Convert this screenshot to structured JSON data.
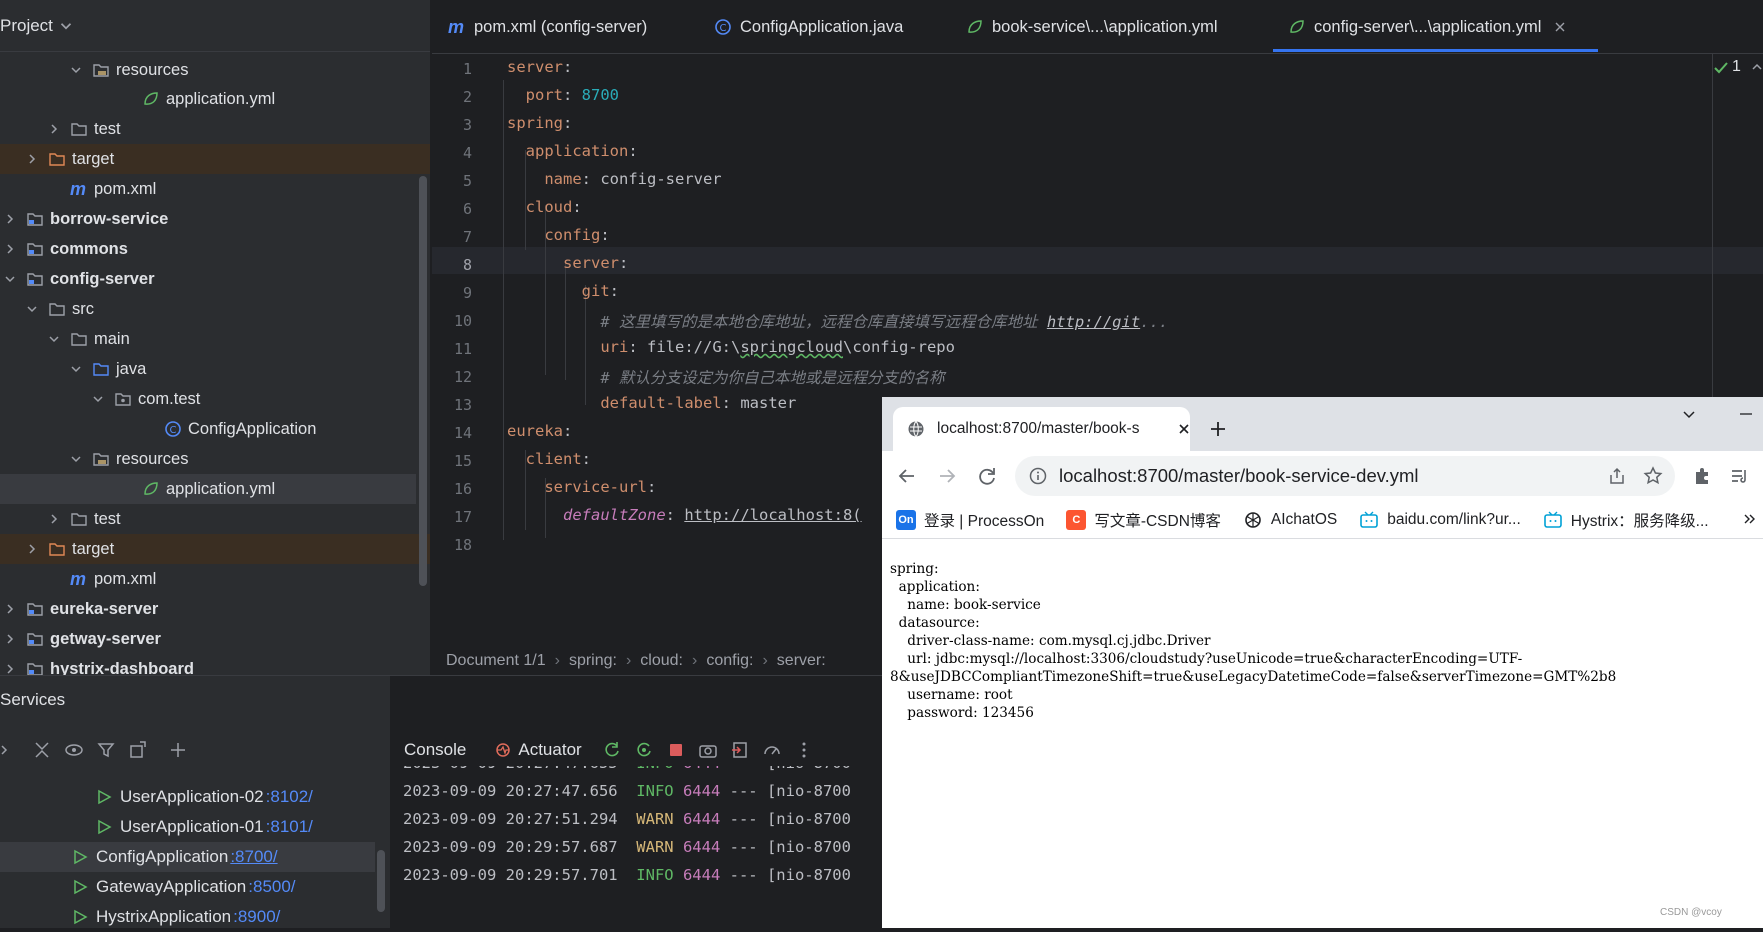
{
  "project": {
    "header": "Project",
    "tree": [
      {
        "label": "resources",
        "type": "folder-res",
        "open": true
      },
      {
        "label": "application.yml",
        "type": "yml"
      },
      {
        "label": "test",
        "type": "folder",
        "open": false
      },
      {
        "label": "target",
        "type": "folder-excl",
        "open": false
      },
      {
        "label": "pom.xml",
        "type": "maven"
      },
      {
        "label": "borrow-service",
        "type": "module",
        "open": false
      },
      {
        "label": "commons",
        "type": "module",
        "open": false
      },
      {
        "label": "config-server",
        "type": "module",
        "open": true
      },
      {
        "label": "src",
        "type": "folder",
        "open": true
      },
      {
        "label": "main",
        "type": "folder",
        "open": true
      },
      {
        "label": "java",
        "type": "folder-src",
        "open": true
      },
      {
        "label": "com.test",
        "type": "package",
        "open": true
      },
      {
        "label": "ConfigApplication",
        "type": "class"
      },
      {
        "label": "resources",
        "type": "folder-res",
        "open": true
      },
      {
        "label": "application.yml",
        "type": "yml"
      },
      {
        "label": "test",
        "type": "folder",
        "open": false
      },
      {
        "label": "target",
        "type": "folder-excl",
        "open": false
      },
      {
        "label": "pom.xml",
        "type": "maven"
      },
      {
        "label": "eureka-server",
        "type": "module",
        "open": false
      },
      {
        "label": "getway-server",
        "type": "module",
        "open": false
      },
      {
        "label": "hystrix-dashboard",
        "type": "module",
        "open": false
      }
    ]
  },
  "editor": {
    "tabs": [
      {
        "label": "pom.xml (config-server)",
        "icon": "maven-icon"
      },
      {
        "label": "ConfigApplication.java",
        "icon": "class-icon"
      },
      {
        "label": "book-service\\...\\application.yml",
        "icon": "yml-icon"
      },
      {
        "label": "config-server\\...\\application.yml",
        "icon": "yml-icon",
        "active": true
      }
    ],
    "line_numbers": [
      "1",
      "2",
      "3",
      "4",
      "5",
      "6",
      "7",
      "8",
      "9",
      "10",
      "11",
      "12",
      "13",
      "14",
      "15",
      "16",
      "17",
      "18"
    ],
    "code": {
      "l1_key": "server",
      "l2_key": "port",
      "l2_val": "8700",
      "l3_key": "spring",
      "l4_key": "application",
      "l5_key": "name",
      "l5_val": "config-server",
      "l6_key": "cloud",
      "l7_key": "config",
      "l8_key": "server",
      "l9_key": "git",
      "l10_comment": "# 这里填写的是本地仓库地址，远程仓库直接填写远程仓库地址 ",
      "l10_link": "http://git",
      "l10_tail": "...",
      "l11_key": "uri",
      "l11_val_a": "file://G:\\",
      "l11_val_b": "springcloud",
      "l11_val_c": "\\config-repo",
      "l12_comment": "# 默认分支设定为你自己本地或是远程分支的名称",
      "l13_key": "default-label",
      "l13_val": "master",
      "l14_key": "eureka",
      "l15_key": "client",
      "l16_key": "service-url",
      "l17_key": "defaultZone",
      "l17_val": "http://localhost:8("
    },
    "breadcrumb": [
      "Document 1/1",
      "spring:",
      "cloud:",
      "config:",
      "server:"
    ],
    "inspection_count": "1"
  },
  "services": {
    "title": "Services",
    "items": [
      {
        "name": "UserApplication-02",
        "port": ":8102/"
      },
      {
        "name": "UserApplication-01",
        "port": ":8101/"
      },
      {
        "name": "ConfigApplication",
        "port": ":8700/",
        "selected": true
      },
      {
        "name": "GatewayApplication",
        "port": ":8500/"
      },
      {
        "name": "HystrixApplication",
        "port": ":8900/"
      }
    ]
  },
  "console": {
    "tabs": [
      "Console",
      "Actuator"
    ],
    "logs": [
      {
        "ts": "2023-09-09 20:27:47.655",
        "level": "INFO",
        "pid": "6444",
        "rest": " --- [nio-8700"
      },
      {
        "ts": "2023-09-09 20:27:47.656",
        "level": "INFO",
        "pid": "6444",
        "rest": " --- [nio-8700"
      },
      {
        "ts": "2023-09-09 20:27:51.294",
        "level": "WARN",
        "pid": "6444",
        "rest": " --- [nio-8700"
      },
      {
        "ts": "2023-09-09 20:29:57.687",
        "level": "WARN",
        "pid": "6444",
        "rest": " --- [nio-8700"
      },
      {
        "ts": "2023-09-09 20:29:57.701",
        "level": "INFO",
        "pid": "6444",
        "rest": " --- [nio-8700"
      }
    ]
  },
  "browser": {
    "tab_title": "localhost:8700/master/book-s",
    "url": "localhost:8700/master/book-service-dev.yml",
    "bookmarks": [
      {
        "label": "登录 | ProcessOn",
        "badge": "On",
        "color": "#1a73e8"
      },
      {
        "label": "写文章-CSDN博客",
        "badge": "C",
        "color": "#fc5531"
      },
      {
        "label": "AIchatOS",
        "badge": "",
        "color": "#202124"
      },
      {
        "label": "baidu.com/link?ur...",
        "badge": "",
        "color": "#00a1d6"
      },
      {
        "label": "Hystrix：服务降级...",
        "badge": "",
        "color": "#00a1d6"
      }
    ],
    "content": "spring:\n  application:\n    name: book-service\n  datasource:\n    driver-class-name: com.mysql.cj.jdbc.Driver\n    url: jdbc:mysql://localhost:3306/cloudstudy?useUnicode=true&characterEncoding=UTF-\n8&useJDBCCompliantTimezoneShift=true&useLegacyDatetimeCode=false&serverTimezone=GMT%2b8\n    username: root\n    password: 123456",
    "watermark": "CSDN @vcoy"
  }
}
